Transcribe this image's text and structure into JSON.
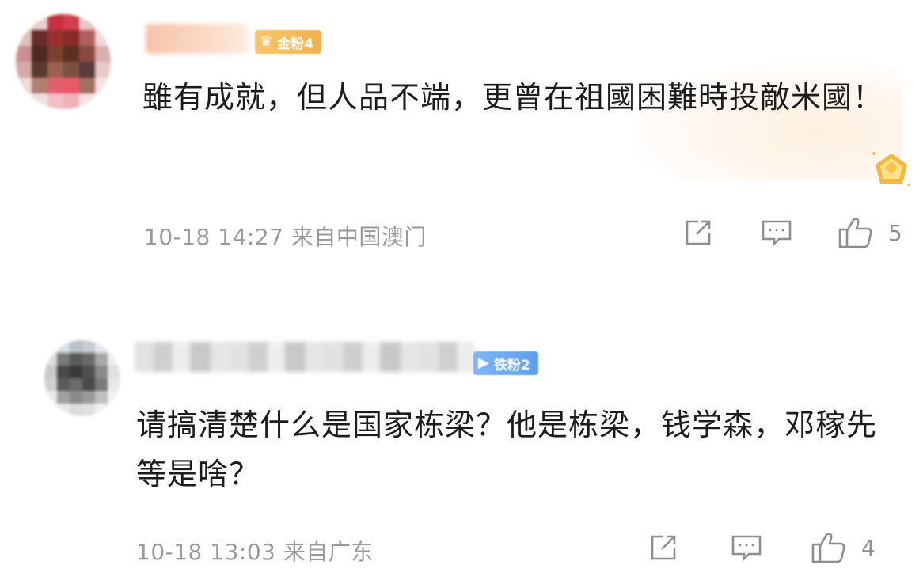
{
  "comments": [
    {
      "badge_label": "金粉4",
      "badge_color": "#f3b04a",
      "badge_icon": "fan-medal-icon",
      "text": "雖有成就，但人品不端，更曾在祖國困難時投敵米國！",
      "timestamp": "10-18 14:27",
      "location": "来自中国澳门",
      "meta": "10-18 14:27 来自中国澳门",
      "like_count": "5",
      "highlighted": true
    },
    {
      "badge_label": "铁粉2",
      "badge_color": "#5b9ef0",
      "badge_icon": "fan-medal-icon",
      "text": "请搞清楚什么是国家栋梁？他是栋梁，钱学森，邓稼先等是啥？",
      "timestamp": "10-18 13:03",
      "location": "来自广东",
      "meta": "10-18 13:03 来自广东",
      "like_count": "4",
      "highlighted": false
    }
  ],
  "icons": {
    "share": "share-icon",
    "reply": "comment-icon",
    "like": "thumbs-up-icon",
    "gold": "gold-diamond-badge-icon"
  },
  "colors": {
    "meta_text": "#9a9a9a",
    "comment_text": "#1c1c1c",
    "icon_gray": "#8e8e8e"
  }
}
